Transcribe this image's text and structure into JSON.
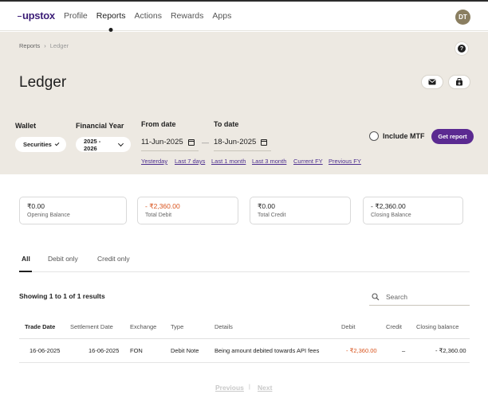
{
  "nav": {
    "logo": "upstox",
    "links": [
      "Profile",
      "Reports",
      "Actions",
      "Rewards",
      "Apps"
    ],
    "active": "Reports",
    "avatar_initials": "DT"
  },
  "breadcrumb": {
    "root": "Reports",
    "separator": "›",
    "current": "Ledger"
  },
  "help_label": "?",
  "title": "Ledger",
  "header_actions": [
    "mail-icon",
    "download-icon"
  ],
  "filters": {
    "wallet_label": "Wallet",
    "wallet_value": "Securities",
    "fy_label": "Financial Year",
    "fy_value": "2025 - 2026",
    "from_label": "From date",
    "from_value": "11-Jun-2025",
    "to_label": "To date",
    "to_value": "18-Jun-2025",
    "date_separator": "—",
    "quick_ranges": [
      "Yesterday",
      "Last 7 days",
      "Last 1 month",
      "Last 3 month",
      "Current FY",
      "Previous FY"
    ],
    "include_mtf_label": "Include MTF",
    "include_mtf_checked": false,
    "get_report_label": "Get report"
  },
  "summary": [
    {
      "amount": "₹0.00",
      "label": "Opening Balance"
    },
    {
      "amount": "- ₹2,360.00",
      "label": "Total Debit"
    },
    {
      "amount": "₹0.00",
      "label": "Total Credit"
    },
    {
      "amount": "- ₹2,360.00",
      "label": "Closing Balance"
    }
  ],
  "tabs": [
    "All",
    "Debit only",
    "Credit only"
  ],
  "active_tab": "All",
  "results_text": "Showing 1 to 1 of 1 results",
  "search": {
    "placeholder": "Search",
    "value": ""
  },
  "table": {
    "columns": [
      "Trade Date",
      "Settlement Date",
      "Exchange",
      "Type",
      "Details",
      "Debit",
      "Credit",
      "Closing balance"
    ],
    "rows": [
      {
        "trade_date": "16-06-2025",
        "settlement_date": "16-06-2025",
        "exchange": "FON",
        "type": "Debit Note",
        "details": "Being amount debited towards API fees",
        "debit": "- ₹2,360.00",
        "credit": "–",
        "closing_balance": "- ₹2,360.00"
      }
    ]
  },
  "pagination": {
    "previous": "Previous",
    "separator": "|",
    "next": "Next"
  },
  "colors": {
    "brand": "#5b2a91",
    "panel_bg": "#ede9e2",
    "debit": "#d9541e",
    "avatar": "#8a7e60"
  }
}
